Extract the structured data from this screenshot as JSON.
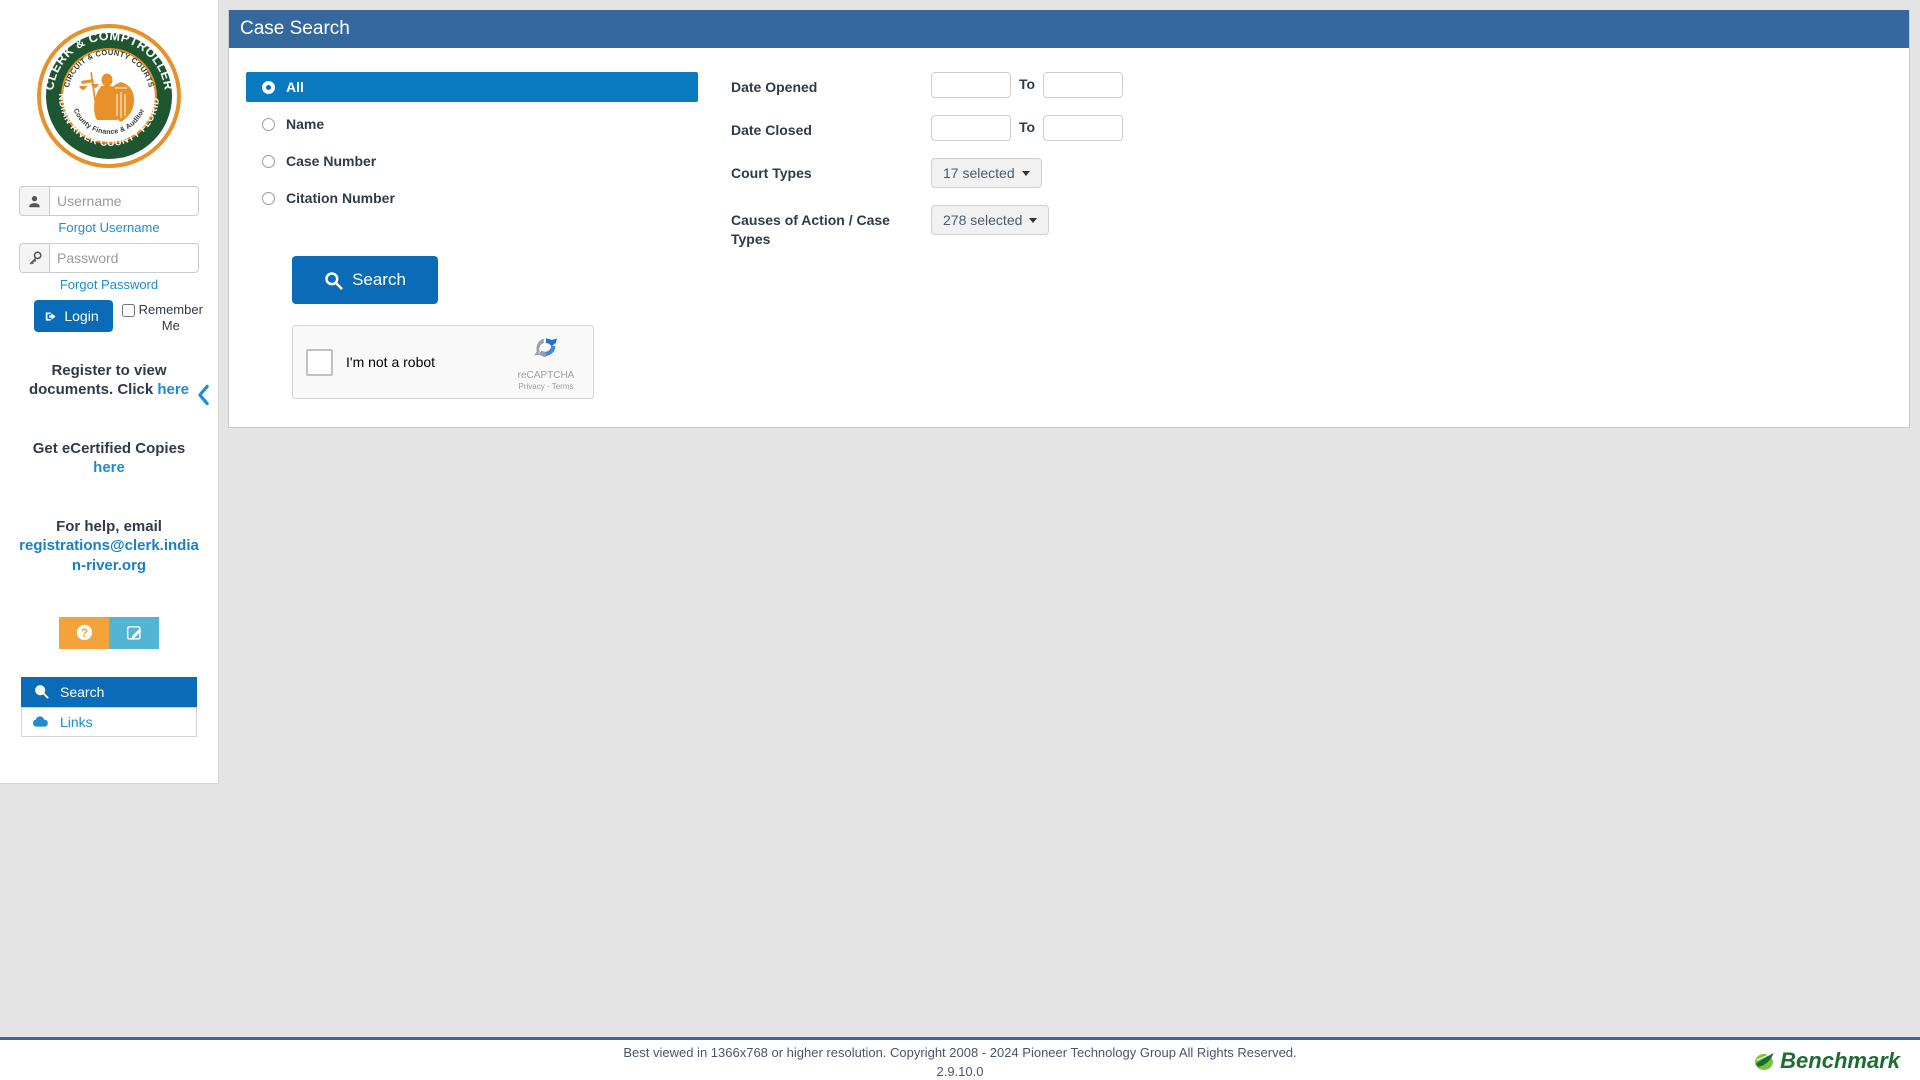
{
  "sidebar": {
    "logo": {
      "icon": "clerk-comptroller-seal",
      "outer_top_text": "CLERK & COMPTROLLER",
      "outer_bottom_text": "INDIAN RIVER COUNTY FLORIDA",
      "inner_top_text": "CIRCUIT & COUNTY COURTS",
      "inner_bottom_text": "County Finance & Auditor",
      "ring_color": "#1d5631",
      "accent_color": "#e8912a"
    },
    "username": {
      "placeholder": "Username",
      "value": "",
      "icon": "user-icon"
    },
    "forgot_username": "Forgot Username",
    "password": {
      "placeholder": "Password",
      "value": "",
      "icon": "key-icon"
    },
    "forgot_password": "Forgot Password",
    "login_button": "Login",
    "remember_me": "Remember Me",
    "register_text_1": "Register to view",
    "register_text_2": "documents. Click",
    "register_link": "here",
    "ecertified_text": "Get eCertified Copies",
    "ecertified_link": "here",
    "help_email_text": "For help, email",
    "help_email_link": "registrations@clerk.indian-river.org",
    "help_button_icon": "question-mark-icon",
    "feedback_button_icon": "pencil-square-icon",
    "help_button_color": "#f2a33c",
    "feedback_button_color": "#54b4d3",
    "nav": [
      {
        "label": "Search",
        "icon": "magnifier-icon",
        "active": true
      },
      {
        "label": "Links",
        "icon": "cloud-icon",
        "active": false
      }
    ],
    "collapse_icon": "chevron-left-icon"
  },
  "main": {
    "title": "Case Search",
    "header_color": "#35699d",
    "search_types": [
      {
        "label": "All",
        "selected": true
      },
      {
        "label": "Name",
        "selected": false
      },
      {
        "label": "Case Number",
        "selected": false
      },
      {
        "label": "Citation Number",
        "selected": false
      }
    ],
    "search_button": {
      "label": "Search",
      "icon": "magnifier-icon",
      "color": "#0a6cb8"
    },
    "recaptcha": {
      "label": "I'm not a robot",
      "brand": "reCAPTCHA",
      "privacy": "Privacy",
      "separator": "-",
      "terms": "Terms",
      "checked": false
    },
    "filters": {
      "date_opened": {
        "label": "Date Opened",
        "from_value": "",
        "from_placeholder": "",
        "to_label": "To",
        "to_value": "",
        "to_placeholder": ""
      },
      "date_closed": {
        "label": "Date Closed",
        "from_value": "",
        "from_placeholder": "",
        "to_label": "To",
        "to_value": "",
        "to_placeholder": ""
      },
      "court_types": {
        "label": "Court Types",
        "value": "17 selected"
      },
      "causes_of_action": {
        "label": "Causes of Action / Case Types",
        "value": "278 selected"
      }
    }
  },
  "footer": {
    "text": "Best viewed in 1366x768 or higher resolution. Copyright 2008 - 2024 Pioneer Technology Group All Rights Reserved.",
    "version": "2.9.10.0",
    "brand": "Benchmark",
    "brand_color": "#1e6b33"
  }
}
